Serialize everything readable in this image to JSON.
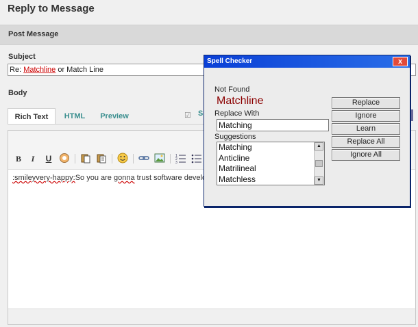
{
  "page": {
    "title": "Reply to Message"
  },
  "section": {
    "label": "Post Message"
  },
  "subject": {
    "label": "Subject",
    "prefix": "Re: ",
    "misspelled": "Matchline",
    "suffix": " or Match Line"
  },
  "body": {
    "label": "Body",
    "tabs": [
      "Rich Text",
      "HTML",
      "Preview"
    ],
    "active_tab": "Rich Text",
    "checkbox_label": "S",
    "editor_text_flagged": ":smileyvery-happy:",
    "editor_text_1": "So you are ",
    "editor_text_flagged_2": "gonna",
    "editor_text_2": " trust software develo"
  },
  "toolbar": {
    "bold": "B",
    "italic": "I",
    "underline": "U",
    "icons": [
      "bold-icon",
      "italic-icon",
      "underline-icon",
      "clear-format-icon",
      "paste-icon",
      "paste-text-icon",
      "emoticon-icon",
      "link-icon",
      "image-icon",
      "numbered-list-icon",
      "bulleted-list-icon"
    ]
  },
  "spell_checker": {
    "title": "Spell Checker",
    "close": "x",
    "not_found_label": "Not Found",
    "not_found_word": "Matchline",
    "replace_with_label": "Replace With",
    "replace_with_value": "Matching",
    "suggestions_label": "Suggestions",
    "suggestions": [
      "Matching",
      "Anticline",
      "Matrilineal",
      "Matchless"
    ],
    "buttons": {
      "replace": "Replace",
      "ignore": "Ignore",
      "learn": "Learn",
      "replace_all": "Replace All",
      "ignore_all": "Ignore All"
    }
  },
  "colors": {
    "accent_link": "#3b8f8f",
    "error_red": "#cc0000",
    "titlebar_blue": "#0a3fd6",
    "not_found_word": "#8b0000"
  }
}
